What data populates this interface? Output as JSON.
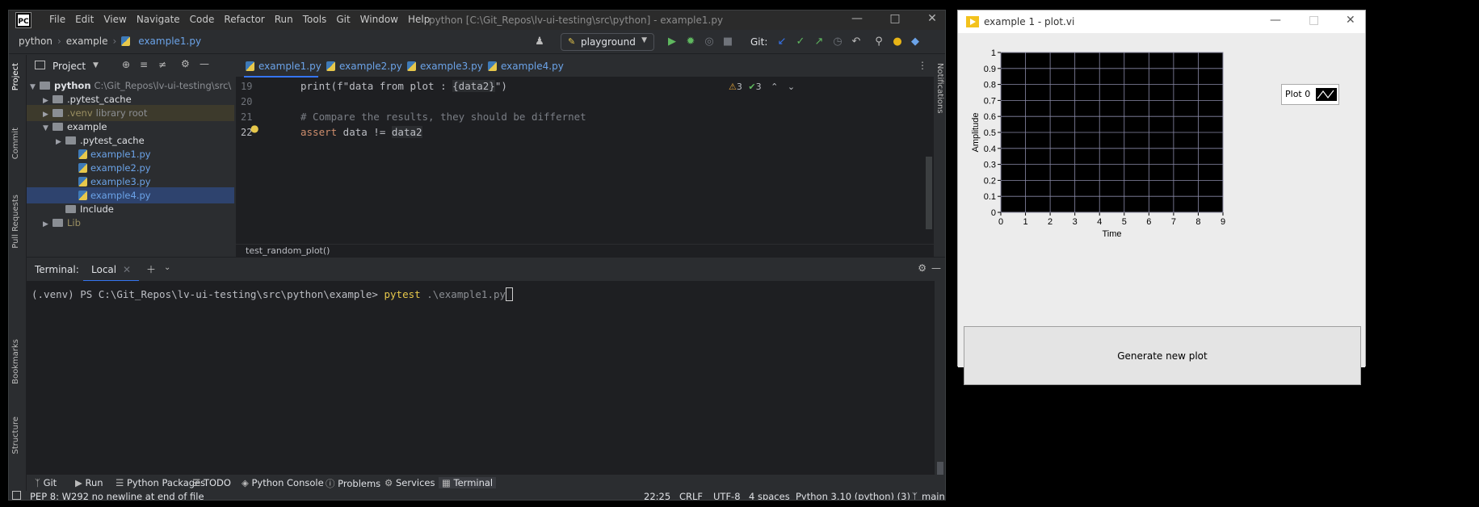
{
  "ide": {
    "menu": [
      "File",
      "Edit",
      "View",
      "Navigate",
      "Code",
      "Refactor",
      "Run",
      "Tools",
      "Git",
      "Window",
      "Help"
    ],
    "window_title": "python [C:\\Git_Repos\\lv-ui-testing\\src\\python] - example1.py",
    "breadcrumbs": [
      "python",
      "example",
      "example1.py"
    ],
    "run_config": "playground",
    "git_label": "Git:",
    "left_tabs": [
      "Project",
      "Commit",
      "Pull Requests",
      "Bookmarks",
      "Structure"
    ],
    "right_tabs": [
      "Notifications"
    ],
    "project_panel": {
      "title": "Project",
      "tree": [
        {
          "label": "python",
          "extra": "C:\\Git_Repos\\lv-ui-testing\\src\\"
        },
        {
          "label": ".pytest_cache",
          "extra": ""
        },
        {
          "label": ".venv",
          "extra": "library root"
        },
        {
          "label": "example",
          "extra": ""
        },
        {
          "label": ".pytest_cache",
          "extra": ""
        },
        {
          "label": "example1.py",
          "extra": ""
        },
        {
          "label": "example2.py",
          "extra": ""
        },
        {
          "label": "example3.py",
          "extra": ""
        },
        {
          "label": "example4.py",
          "extra": ""
        },
        {
          "label": "Include",
          "extra": ""
        },
        {
          "label": "Lib",
          "extra": ""
        }
      ]
    },
    "editor_tabs": [
      "example1.py",
      "example2.py",
      "example3.py",
      "example4.py"
    ],
    "code_lines": [
      {
        "num": "19",
        "parts": [
          [
            "print(f\"data from plot : ",
            "plain"
          ],
          [
            "{data2}",
            "hl"
          ],
          [
            "\")",
            "plain"
          ]
        ]
      },
      {
        "num": "20",
        "parts": []
      },
      {
        "num": "21",
        "parts": [
          [
            "# Compare the results, they should be differnet",
            "cm"
          ]
        ]
      },
      {
        "num": "22",
        "parts": [
          [
            "assert",
            "kw"
          ],
          [
            " data != ",
            "plain"
          ],
          [
            "data2",
            "hl"
          ]
        ]
      }
    ],
    "inspections": {
      "warnings": "3",
      "ok": "3"
    },
    "function_crumb": "test_random_plot()",
    "terminal": {
      "title": "Terminal:",
      "tab": "Local",
      "prompt": "(.venv) PS C:\\Git_Repos\\lv-ui-testing\\src\\python\\example>",
      "command": "pytest",
      "argument": ".\\example1.py"
    },
    "bottom_tabs": [
      "Git",
      "Run",
      "Python Packages",
      "TODO",
      "Python Console",
      "Problems",
      "Services",
      "Terminal"
    ],
    "status": {
      "message": "PEP 8: W292 no newline at end of file",
      "position": "22:25",
      "line_sep": "CRLF",
      "encoding": "UTF-8",
      "indent": "4 spaces",
      "interpreter": "Python 3.10 (python) (3)",
      "branch": "main"
    }
  },
  "labview": {
    "title": "example 1 - plot.vi",
    "legend_label": "Plot 0",
    "button_label": "Generate new plot",
    "chart_data": {
      "type": "line",
      "xlabel": "Time",
      "ylabel": "Amplitude",
      "xlim": [
        0,
        9
      ],
      "ylim": [
        0,
        1
      ],
      "x_ticks": [
        "0",
        "1",
        "2",
        "3",
        "4",
        "5",
        "6",
        "7",
        "8",
        "9"
      ],
      "y_ticks": [
        "0",
        "0.1",
        "0.2",
        "0.3",
        "0.4",
        "0.5",
        "0.6",
        "0.7",
        "0.8",
        "0.9",
        "1"
      ],
      "grid": true,
      "legend": "top-right",
      "series": []
    }
  }
}
